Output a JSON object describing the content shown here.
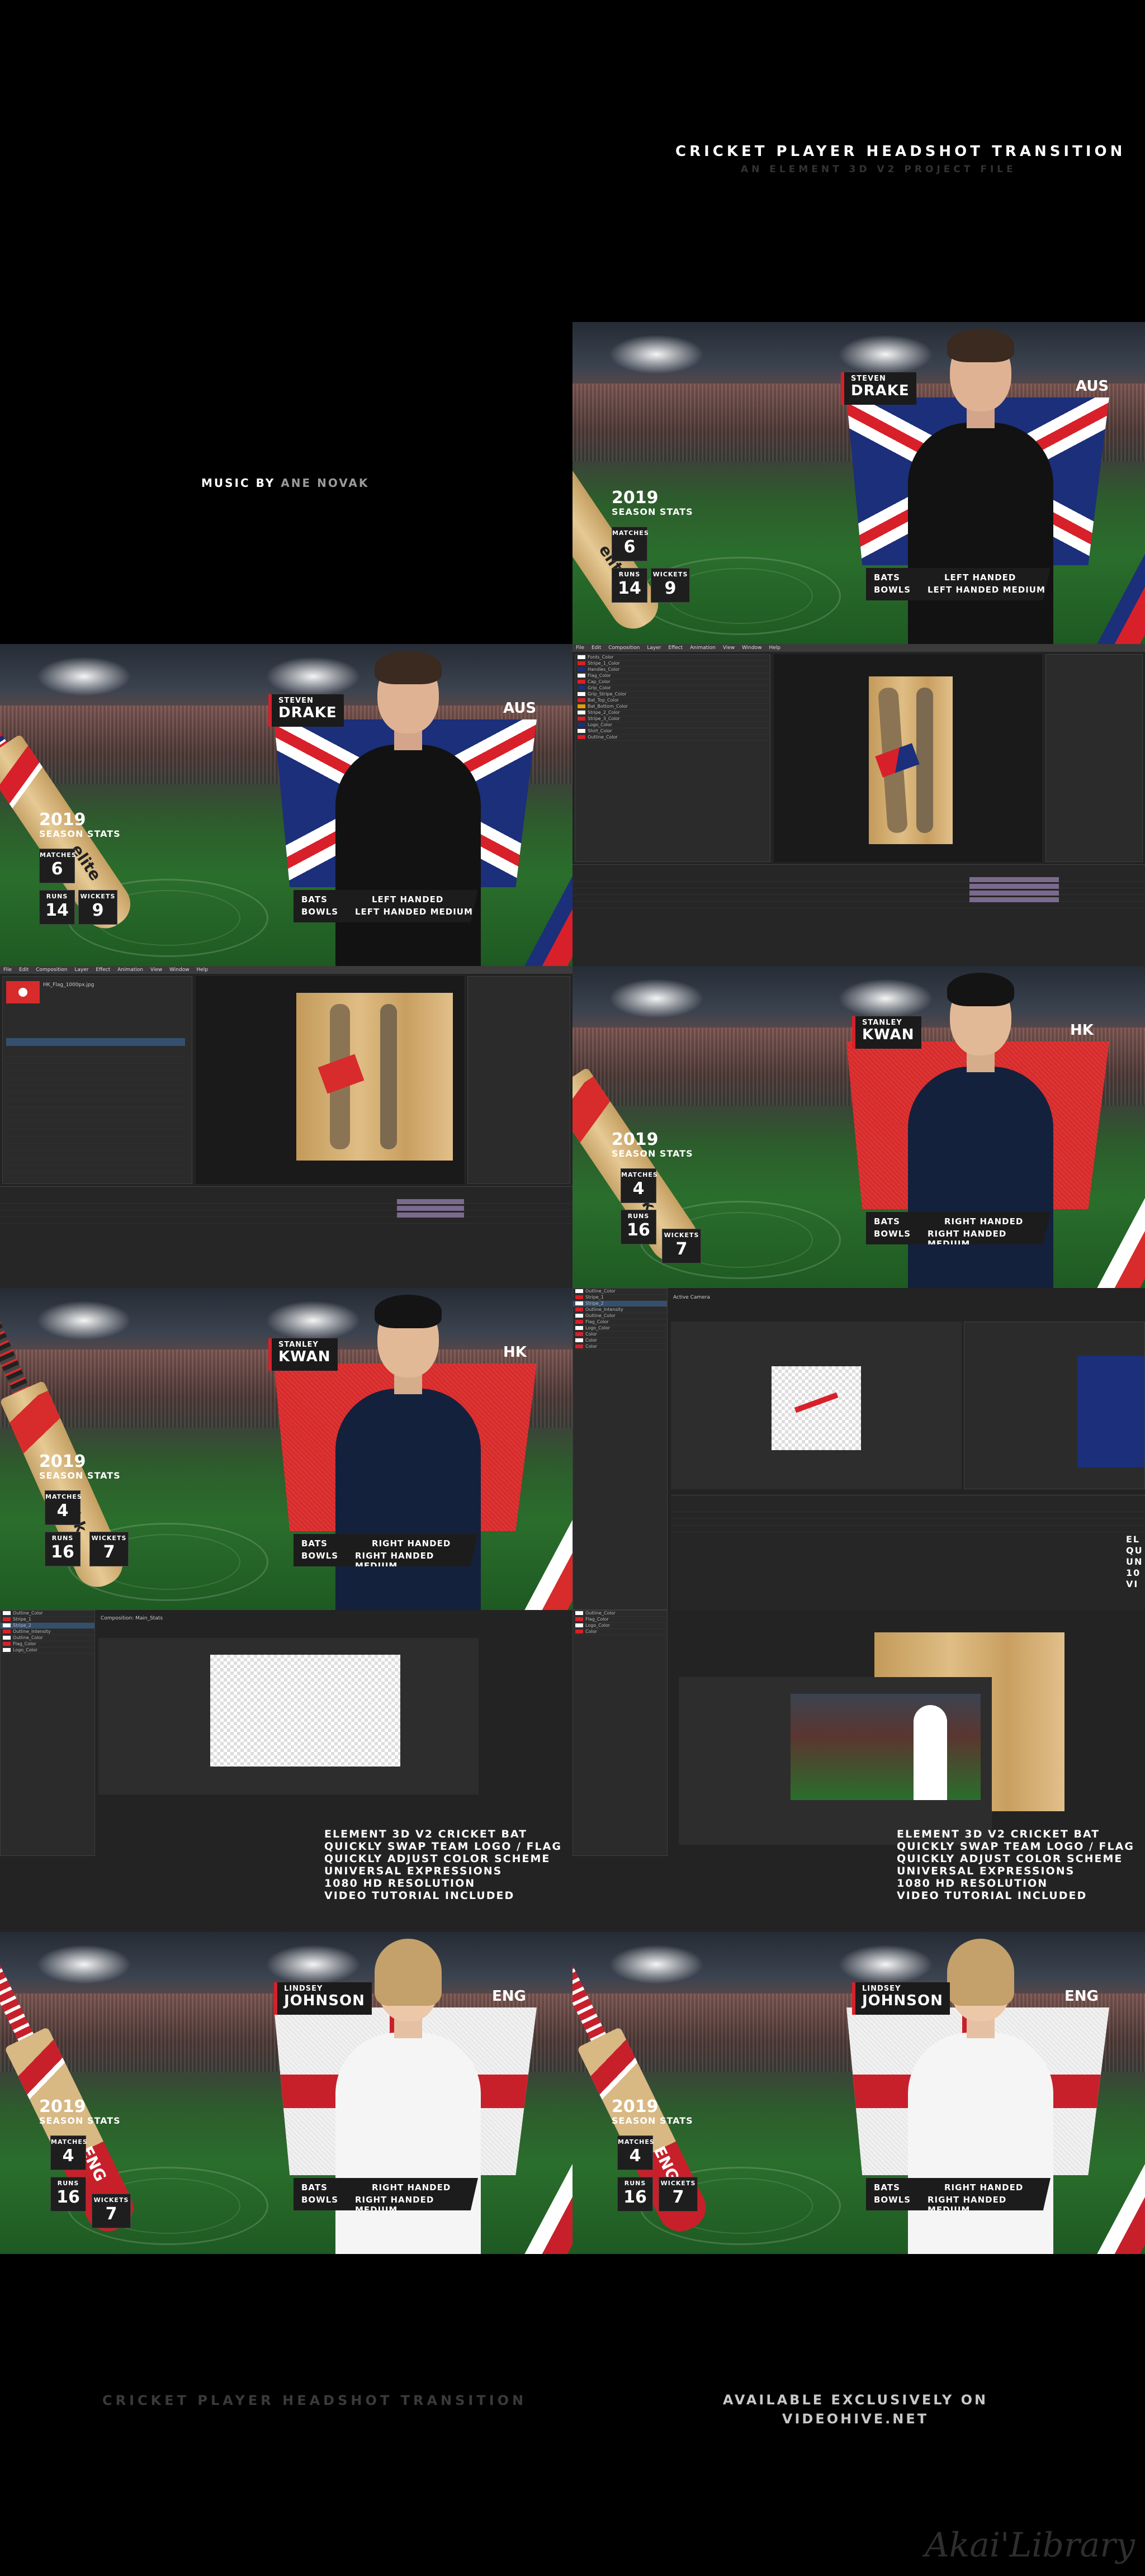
{
  "header": {
    "title": "CRICKET PLAYER HEADSHOT TRANSITION",
    "subtitle": "AN ELEMENT 3D V2 PROJECT FILE"
  },
  "music_credit": {
    "prefix": "MUSIC BY",
    "name": "ANE NOVAK"
  },
  "players": {
    "drake": {
      "first": "STEVEN",
      "last": "DRAKE",
      "country": "AUS",
      "year": "2019",
      "season": "SEASON STATS",
      "matches_label": "MATCHES",
      "matches": "6",
      "runs_label": "RUNS",
      "runs": "14",
      "wickets_label": "WICKETS",
      "wickets": "9",
      "bats_label": "BATS",
      "bats": "LEFT HANDED",
      "bowls_label": "BOWLS",
      "bowls": "LEFT HANDED MEDIUM",
      "bat_brand": "elite"
    },
    "kwan": {
      "first": "STANLEY",
      "last": "KWAN",
      "country": "HK",
      "year": "2019",
      "season": "SEASON STATS",
      "matches_label": "MATCHES",
      "matches": "4",
      "runs_label": "RUNS",
      "runs": "16",
      "wickets_label": "WICKETS",
      "wickets": "7",
      "bats_label": "BATS",
      "bats": "RIGHT HANDED",
      "bowls_label": "BOWLS",
      "bowls": "RIGHT HANDED MEDIUM",
      "bat_brand": "hk"
    },
    "johnson": {
      "first": "LINDSEY",
      "last": "JOHNSON",
      "country": "ENG",
      "year": "2019",
      "season": "SEASON STATS",
      "matches_label": "MATCHES",
      "matches": "4",
      "runs_label": "RUNS",
      "runs": "16",
      "wickets_label": "WICKETS",
      "wickets": "7",
      "bats_label": "BATS",
      "bats": "RIGHT HANDED",
      "bowls_label": "BOWLS",
      "bowls": "RIGHT HANDED MEDIUM",
      "bat_brand": "ENG"
    }
  },
  "ae": {
    "menu": [
      "File",
      "Edit",
      "Composition",
      "Layer",
      "Effect",
      "Animation",
      "View",
      "Window",
      "Help"
    ],
    "effect_rows_a": [
      "Fonts_Color",
      "Stripe_1_Color",
      "Handles_Color",
      "Flag_Color",
      "Cap_Color",
      "Grip_Color",
      "Grip_Stripe_Color",
      "Bat_Top_Color",
      "Bat_Bottom_Color",
      "Stripe_2_Color",
      "Stripe_3_Color",
      "Logo_Color",
      "Shirt_Color",
      "Outline_Color"
    ],
    "effect_rows_b": [
      "Outline_Color",
      "Stripe_1",
      "Stripe_2",
      "Outline_Intensity",
      "Outline_Color",
      "Flag_Color",
      "Logo_Color",
      "Color",
      "Color",
      "Color"
    ],
    "active_camera": "Active Camera",
    "project_file": "HK_Flag_1000px.jpg",
    "composition": "Composition: Main_Stats"
  },
  "features": {
    "lines": [
      "ELEMENT 3D V2 CRICKET BAT",
      "QUICKLY SWAP TEAM LOGO / FLAG",
      "QUICKLY  ADJUST COLOR SCHEME",
      "UNIVERSAL EXPRESSIONS",
      "1080 HD RESOLUTION",
      "VIDEO TUTORIAL INCLUDED"
    ],
    "partial_lines": [
      "EL",
      "QU",
      "UN",
      "10",
      "VI"
    ]
  },
  "footer": {
    "left": "CRICKET PLAYER HEADSHOT TRANSITION",
    "right_line1": "AVAILABLE EXCLUSIVELY ON",
    "right_line2": "VIDEOHIVE.NET"
  },
  "watermark": "Akai'Library",
  "colors": {
    "red": "#d8202a",
    "aus_blue": "#1b2f7a",
    "hk_red": "#d82b2b",
    "eng_red": "#c8202a",
    "title_sub_gray": "#333333"
  }
}
